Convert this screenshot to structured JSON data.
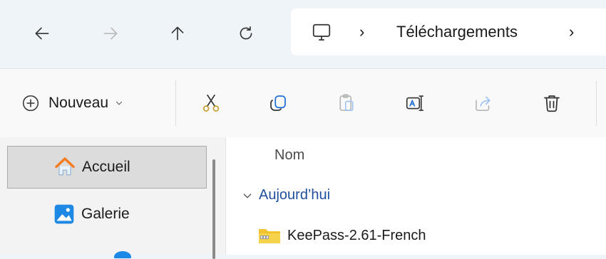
{
  "navigation": {
    "back_icon": "arrow-left-icon",
    "forward_icon": "arrow-right-icon",
    "up_icon": "arrow-up-icon",
    "refresh_icon": "refresh-icon"
  },
  "address_bar": {
    "root_icon": "computer-icon",
    "separator": "›",
    "crumb": "Téléchargements",
    "trailing_separator": "›"
  },
  "toolbar": {
    "new_label": "Nouveau",
    "tools": [
      "cut-icon",
      "copy-icon",
      "paste-icon",
      "rename-icon",
      "share-icon",
      "delete-icon"
    ]
  },
  "sidebar": {
    "items": [
      {
        "label": "Accueil",
        "icon": "home-icon",
        "selected": true
      },
      {
        "label": "Galerie",
        "icon": "gallery-icon",
        "selected": false
      }
    ]
  },
  "content": {
    "column_header": "Nom",
    "group_label": "Aujourd’hui",
    "files": [
      {
        "name": "KeePass-2.61-French",
        "icon": "zip-folder-icon"
      }
    ]
  },
  "colors": {
    "navbar_bg": "#eff4f9",
    "group_text": "#1f4e9c",
    "selected_bg": "#dcdcdc",
    "home_orange": "#f57c1f",
    "gallery_blue": "#1e88e5"
  }
}
